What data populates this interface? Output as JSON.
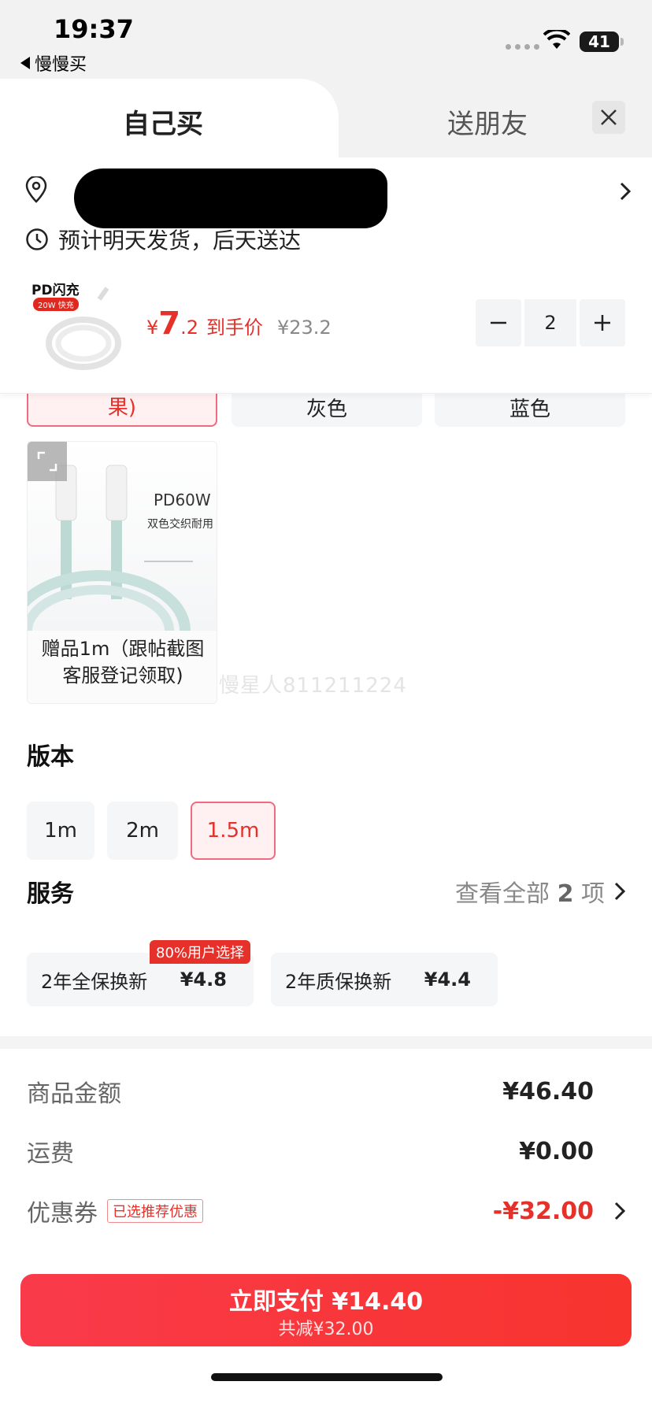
{
  "status": {
    "time": "19:37",
    "back_app": "慢慢买",
    "battery": "41"
  },
  "tabs": {
    "self": "自己买",
    "gift": "送朋友"
  },
  "delivery": "预计明天发货，后天送达",
  "product": {
    "thumb_title": "PD闪充",
    "thumb_badge": "20W 快充",
    "price_yen": "¥",
    "price_int": "7",
    "price_dec": ".2",
    "price_label": "到手价",
    "orig_price": "¥23.2",
    "quantity": "2"
  },
  "colors": {
    "options": [
      "果)",
      "灰色",
      "蓝色"
    ],
    "selected_index": 0
  },
  "gift_item": {
    "img_title": "PD60W",
    "img_subtitle": "双色交织耐用",
    "caption_line1": "赠品1m（跟帖截图",
    "caption_line2": "客服登记领取)"
  },
  "watermark": "慢星人811211224",
  "version": {
    "title": "版本",
    "options": [
      "1m",
      "2m",
      "1.5m"
    ],
    "selected_index": 2
  },
  "service": {
    "title": "服务",
    "see_all": "查看全部",
    "see_all_count": "2",
    "see_all_unit": "项",
    "tag": "80%用户选择",
    "options": [
      {
        "name": "2年全保换新",
        "price": "¥4.8"
      },
      {
        "name": "2年质保换新",
        "price": "¥4.4"
      }
    ]
  },
  "summary": {
    "goods_label": "商品金额",
    "goods_value": "¥46.40",
    "shipping_label": "运费",
    "shipping_value": "¥0.00",
    "coupon_label": "优惠券",
    "coupon_tag": "已选推荐优惠",
    "coupon_value": "-¥32.00"
  },
  "pay": {
    "main": "立即支付 ¥14.40",
    "sub": "共减¥32.00"
  },
  "colors_theme": {
    "accent": "#e6312b",
    "selected_bg": "#fff0f2",
    "chip_bg": "#f5f6f8"
  }
}
